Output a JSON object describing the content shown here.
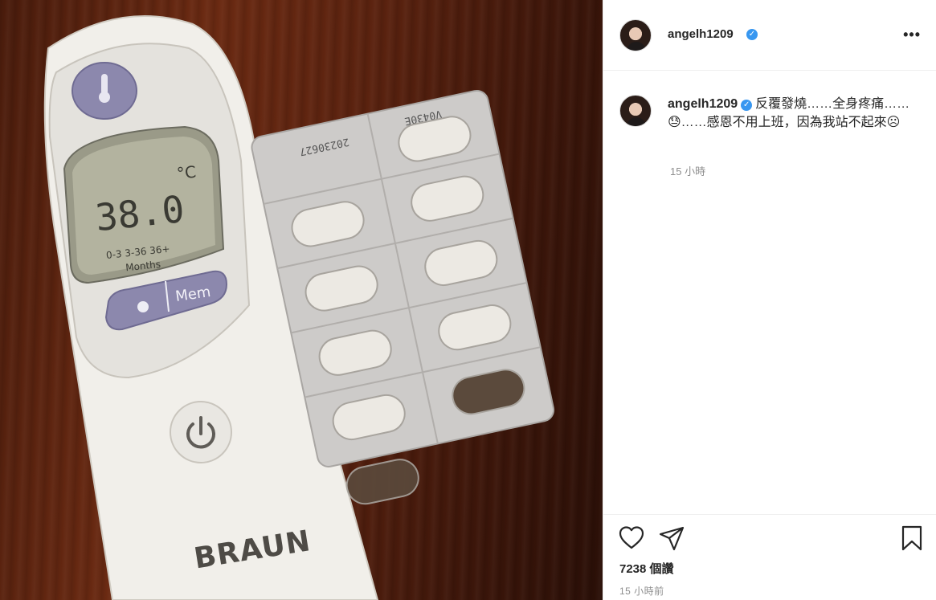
{
  "post": {
    "username": "angelh1209",
    "caption_text": "反覆發燒……全身疼痛……😓……感恩不用上班，因為我站不起來☹",
    "caption_time": "15 小時",
    "likes_text": "7238 個讚",
    "post_time": "15 小時前"
  },
  "photo": {
    "thermometer_reading": "38.0",
    "thermometer_unit": "°C",
    "mem_label": "Mem",
    "brand_label": "BRAUN",
    "age_groups": "0-3  3-36  36+",
    "months_label": "Months",
    "blister_code": "20230627",
    "blister_code_b": "V0430E"
  },
  "icons": {
    "more": "more-options-icon",
    "like": "heart-icon",
    "share": "paper-plane-icon",
    "save": "bookmark-icon",
    "verified": "verified-badge-icon"
  },
  "colors": {
    "verified": "#3897f0",
    "secondary_text": "#8e8e8e",
    "primary_text": "#262626"
  }
}
